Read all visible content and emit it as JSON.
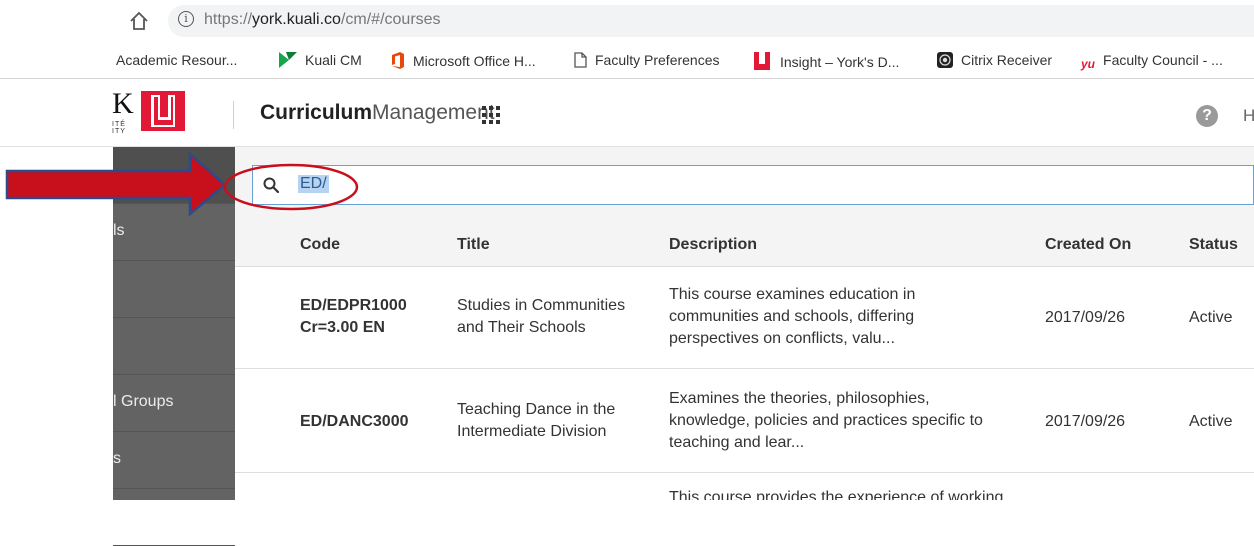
{
  "browser": {
    "url_prefix": "https://",
    "url_host": "york.kuali.co",
    "url_path": "/cm/#/courses",
    "bookmarks": [
      {
        "label": "Academic Resour...",
        "icon": "bookmark-icon"
      },
      {
        "label": "Kuali CM",
        "icon": "kuali-icon"
      },
      {
        "label": "Microsoft Office H...",
        "icon": "office-icon"
      },
      {
        "label": "Faculty Preferences",
        "icon": "page-icon"
      },
      {
        "label": "Insight – York's D...",
        "icon": "insight-icon"
      },
      {
        "label": "Citrix Receiver",
        "icon": "citrix-icon"
      },
      {
        "label": "Faculty Council - ...",
        "icon": "yu-icon"
      }
    ]
  },
  "header": {
    "logo_letter": "K",
    "logo_small": "ITÉ\nITY",
    "title_bold": "Curriculum",
    "title_light": "Management",
    "help_label": "H",
    "help_glyph": "?"
  },
  "sidebar": {
    "items": [
      {
        "label": ""
      },
      {
        "label": "ls"
      },
      {
        "label": ""
      },
      {
        "label": ""
      },
      {
        "label": "l Groups"
      },
      {
        "label": "s"
      },
      {
        "label": ""
      }
    ]
  },
  "search": {
    "value": "ED/"
  },
  "table": {
    "columns": [
      "Code",
      "Title",
      "Description",
      "Created On",
      "Status"
    ],
    "rows": [
      {
        "code_line1": "ED/EDPR1000",
        "code_line2": "Cr=3.00 EN",
        "title_line1": "Studies in Communities",
        "title_line2": "and Their Schools",
        "desc_line1": "This course examines education in",
        "desc_line2": "communities and schools, differing",
        "desc_line3": "perspectives on conflicts, valu...",
        "created": "2017/09/26",
        "status": "Active"
      },
      {
        "code_line1": "ED/DANC3000",
        "code_line2": "",
        "title_line1": "Teaching Dance in the",
        "title_line2": "Intermediate Division",
        "desc_line1": "Examines the theories, philosophies,",
        "desc_line2": "knowledge, policies and practices specific to",
        "desc_line3": "teaching and lear...",
        "created": "2017/09/26",
        "status": "Active"
      },
      {
        "code_line1": "",
        "code_line2": "",
        "title_line1": "",
        "title_line2": "",
        "desc_line1": "This course provides the experience of working",
        "desc_line2": "",
        "desc_line3": "",
        "created": "",
        "status": ""
      }
    ]
  },
  "colors": {
    "brand_red": "#e31837",
    "arrow_red": "#c8101d",
    "arrow_outline": "#2f4a8a",
    "sidebar_bg": "#636363",
    "search_highlight": "#b7d3f2"
  }
}
